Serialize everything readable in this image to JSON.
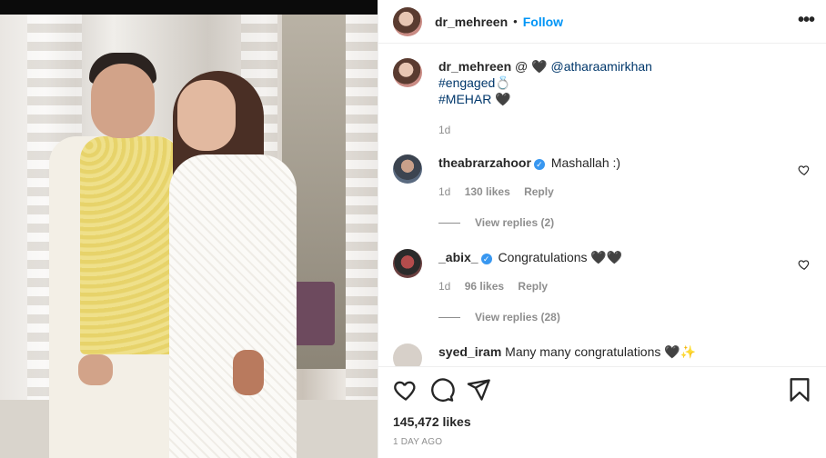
{
  "post": {
    "username": "dr_mehreen",
    "dot": "•",
    "follow_label": "Follow",
    "more_label": "•••"
  },
  "caption": {
    "username": "dr_mehreen",
    "text_prefix": "@ 🖤 ",
    "mention": "@atharaamirkhan",
    "hashtag1": "#engaged💍",
    "hashtag2": "#MEHAR",
    "suffix": " 🖤",
    "time": "1d"
  },
  "comments": [
    {
      "username": "theabrarzahoor",
      "text": "Mashallah :)",
      "time": "1d",
      "likes": "130 likes",
      "reply": "Reply",
      "view_replies": "View replies (2)",
      "avatar_color": "#4a5566"
    },
    {
      "username": "_abix_",
      "text": "Congratulations 🖤🖤",
      "time": "1d",
      "likes": "96 likes",
      "reply": "Reply",
      "view_replies": "View replies (28)",
      "avatar_color": "#7a3b3b"
    },
    {
      "username": "syed_iram",
      "text": "Many many congratulations 🖤✨",
      "avatar_color": "#d7d0c9"
    }
  ],
  "actions": {
    "likes": "145,472 likes",
    "time": "1 DAY AGO"
  },
  "colors": {
    "follow": "#0095f6",
    "link": "#00376b",
    "muted": "#8e8e8e",
    "verified": "#3897f0"
  }
}
